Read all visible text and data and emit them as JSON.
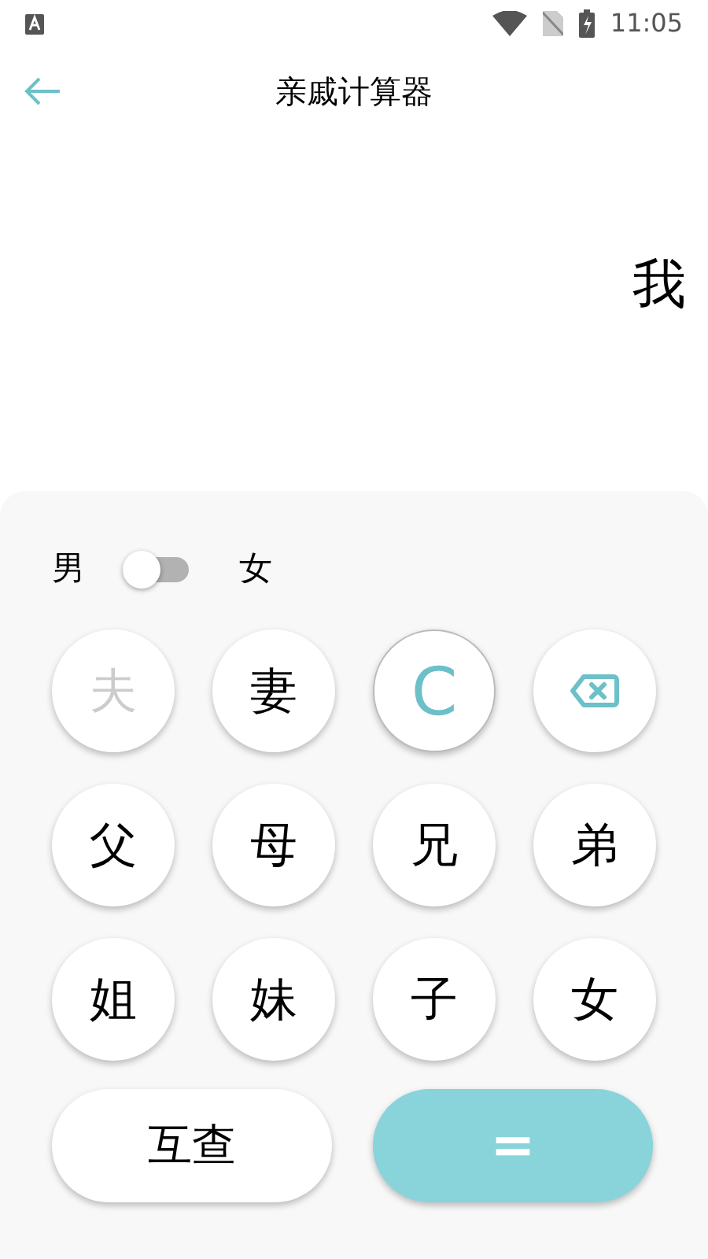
{
  "status_bar": {
    "time": "11:05"
  },
  "app_bar": {
    "title": "亲戚计算器"
  },
  "display": {
    "value": "我"
  },
  "gender": {
    "left_label": "男",
    "right_label": "女",
    "on": false
  },
  "keys": [
    {
      "kind": "text",
      "label": "夫",
      "disabled": true
    },
    {
      "kind": "text",
      "label": "妻",
      "disabled": false
    },
    {
      "kind": "clear",
      "label": "C",
      "disabled": false
    },
    {
      "kind": "backspace",
      "disabled": false
    },
    {
      "kind": "text",
      "label": "父",
      "disabled": false
    },
    {
      "kind": "text",
      "label": "母",
      "disabled": false
    },
    {
      "kind": "text",
      "label": "兄",
      "disabled": false
    },
    {
      "kind": "text",
      "label": "弟",
      "disabled": false
    },
    {
      "kind": "text",
      "label": "姐",
      "disabled": false
    },
    {
      "kind": "text",
      "label": "妹",
      "disabled": false
    },
    {
      "kind": "text",
      "label": "子",
      "disabled": false
    },
    {
      "kind": "text",
      "label": "女",
      "disabled": false
    }
  ],
  "actions": [
    {
      "kind": "secondary",
      "label": "互查"
    },
    {
      "kind": "primary",
      "label": "="
    }
  ]
}
